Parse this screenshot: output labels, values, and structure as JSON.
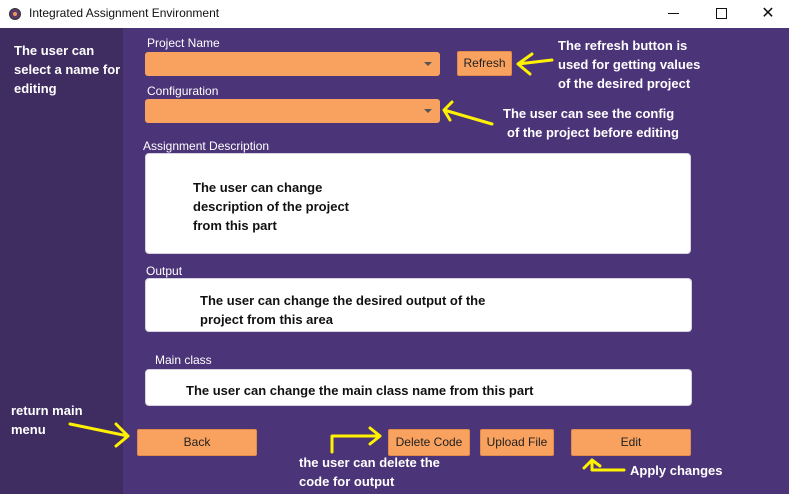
{
  "window": {
    "title": "Integrated Assignment Environment",
    "minimize_icon": "minimize-icon",
    "maximize_icon": "maximize-icon",
    "close_symbol": "✕"
  },
  "form": {
    "project_name_label": "Project Name",
    "project_name_value": "",
    "refresh_label": "Refresh",
    "configuration_label": "Configuration",
    "configuration_value": "",
    "description_label": "Assignment Description",
    "description_value": "",
    "output_label": "Output",
    "output_value": "",
    "main_class_label": "Main class",
    "main_class_value": ""
  },
  "buttons": {
    "back": "Back",
    "delete_code": "Delete Code",
    "upload_file": "Upload File",
    "edit": "Edit"
  },
  "annotations": {
    "select_name": [
      "The user can",
      "select a name for",
      "editing"
    ],
    "refresh": [
      "The refresh button is",
      "used for getting values",
      "of the desired project"
    ],
    "config": [
      "The user can see the config",
      "of the project before editing"
    ],
    "description": [
      "The user can change",
      "description of the project",
      "from this part"
    ],
    "output": [
      "The user can change the desired output of the",
      "project from this area"
    ],
    "main_class": "The user can change the main class name from this part",
    "return": [
      "return main",
      "menu"
    ],
    "delete": [
      "the user can delete the",
      "code for output"
    ],
    "apply": "Apply changes"
  },
  "colors": {
    "sidebar": "#3f2d62",
    "main": "#4c3478",
    "accent": "#f9a15e",
    "arrow": "#fff200"
  }
}
